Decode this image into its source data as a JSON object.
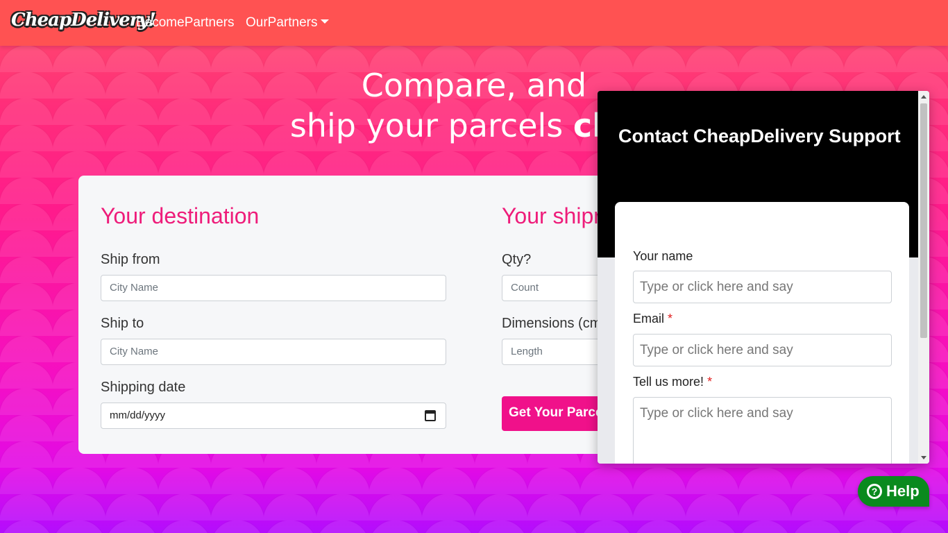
{
  "navbar": {
    "brand": "CheapDelivery!",
    "become_partners": "BecomePartners",
    "our_partners": "OurPartners"
  },
  "hero": {
    "line1": "Compare, and",
    "line2_prefix": "ship your parcels ",
    "line2_bold": "chea"
  },
  "destination": {
    "title": "Your destination",
    "ship_from_label": "Ship from",
    "ship_from_placeholder": "City Name",
    "ship_to_label": "Ship to",
    "ship_to_placeholder": "City Name",
    "shipping_date_label": "Shipping date",
    "shipping_date_value": "mm/dd/yyyy"
  },
  "shipment": {
    "title": "Your shipr",
    "qty_label": "Qty?",
    "qty_placeholder": "Count",
    "dimensions_label": "Dimensions (cm",
    "length_placeholder": "Length",
    "submit_label": "Get Your Parce"
  },
  "support": {
    "title": "Contact CheapDelivery Support",
    "name_label": "Your name",
    "email_label": "Email",
    "more_label": "Tell us more!",
    "required_mark": "*",
    "input_placeholder": "Type or click here and say"
  },
  "help_button": {
    "label": "Help",
    "icon": "question-circle-icon"
  },
  "colors": {
    "navbar": "#ff5252",
    "accent": "#ee1c7a",
    "button": "#f0118a",
    "help": "#0a8a1e"
  }
}
